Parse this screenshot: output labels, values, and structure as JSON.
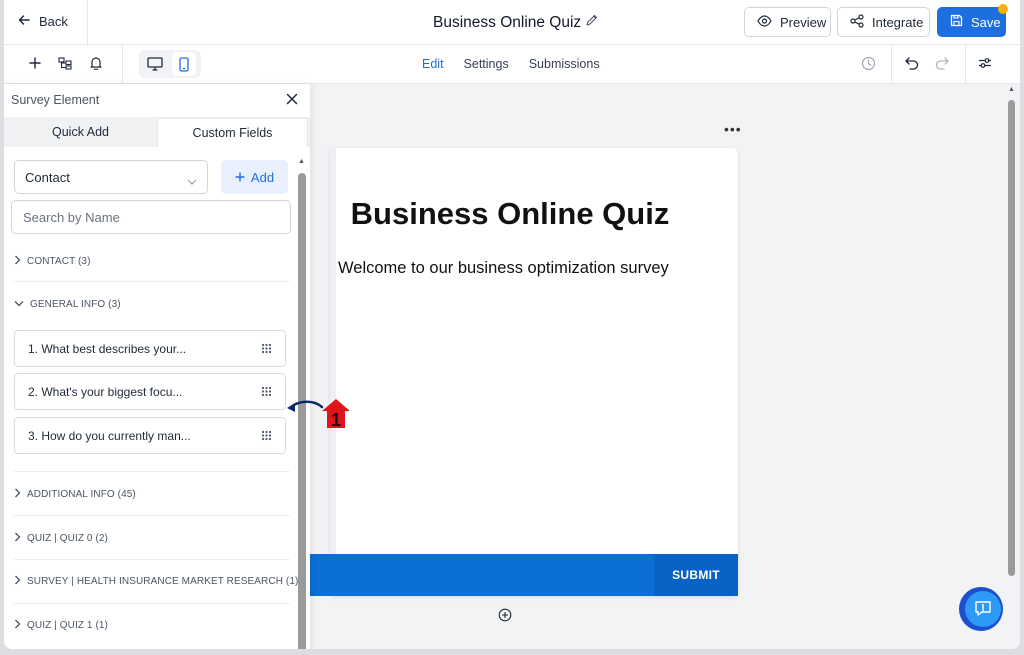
{
  "topbar": {
    "back_label": "Back",
    "title": "Business Online Quiz",
    "preview_label": "Preview",
    "integrate_label": "Integrate",
    "save_label": "Save"
  },
  "toolbar": {
    "tabs": [
      {
        "label": "Edit",
        "active": true
      },
      {
        "label": "Settings",
        "active": false
      },
      {
        "label": "Submissions",
        "active": false
      }
    ]
  },
  "panel": {
    "title": "Survey Element",
    "tabs": [
      {
        "label": "Quick Add",
        "selected": false
      },
      {
        "label": "Custom Fields",
        "selected": true
      }
    ],
    "category_select": "Contact",
    "add_label": "Add",
    "search_placeholder": "Search by Name",
    "categories": [
      {
        "label": "CONTACT (3)",
        "expanded": false
      },
      {
        "label": "GENERAL INFO (3)",
        "expanded": true
      },
      {
        "label": "ADDITIONAL INFO (45)",
        "expanded": false
      },
      {
        "label": "QUIZ | QUIZ 0 (2)",
        "expanded": false
      },
      {
        "label": "SURVEY | HEALTH INSURANCE MARKET RESEARCH (1)",
        "expanded": false
      },
      {
        "label": "QUIZ | QUIZ 1 (1)",
        "expanded": false
      }
    ],
    "general_info_items": [
      "1. What best describes your...",
      "2. What's your biggest focu...",
      "3. How do you currently man..."
    ]
  },
  "canvas": {
    "form_title": "Business Online Quiz",
    "form_subtitle": "Welcome to our business optimization survey",
    "submit_label": "SUBMIT"
  },
  "annotation": {
    "step_number": "1"
  },
  "colors": {
    "accent": "#1d6fe0",
    "submit_bar": "#0a6fd6",
    "marker": "#e0151b"
  }
}
